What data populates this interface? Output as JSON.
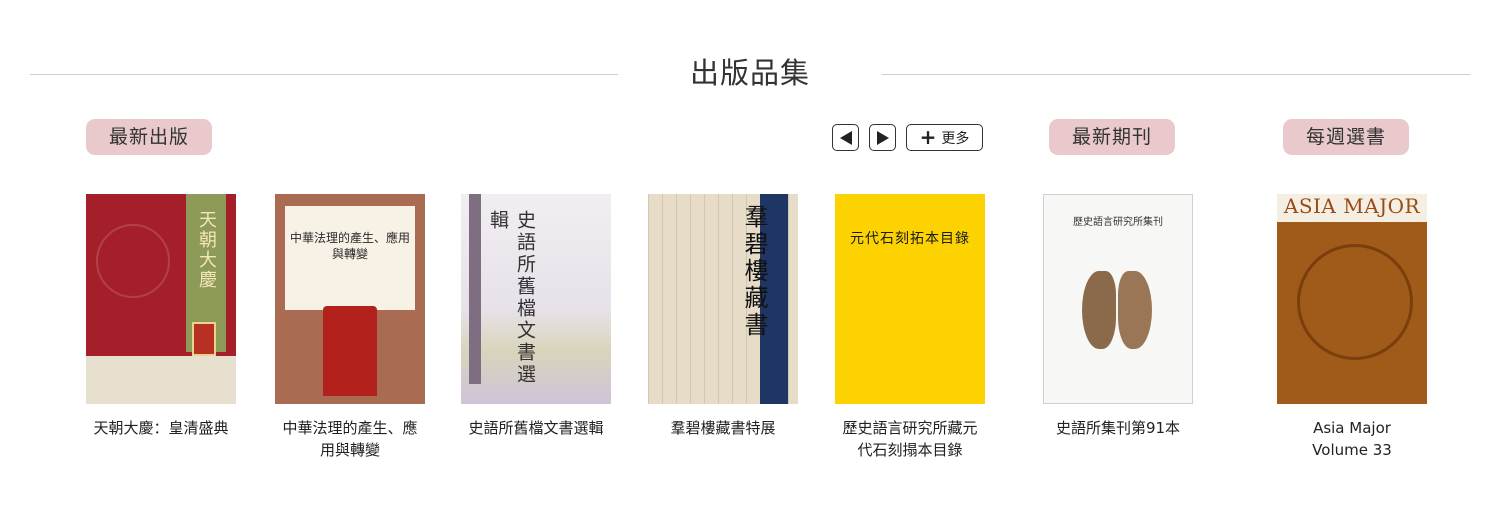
{
  "section": {
    "title": "出版品集"
  },
  "labels": {
    "latest_publications": "最新出版",
    "latest_journals": "最新期刊",
    "weekly_pick": "每週選書",
    "more": "更多"
  },
  "books": [
    {
      "caption": "天朝大慶：皇清盛典",
      "cover_text": "天朝大慶"
    },
    {
      "caption": "中華法理的產生、應用與轉變",
      "cover_text": "中華法理的產生、應用與轉變"
    },
    {
      "caption": "史語所舊檔文書選輯",
      "cover_text": "史語所舊檔文書選輯"
    },
    {
      "caption": "羣碧樓藏書特展",
      "cover_text": "羣碧樓藏書"
    },
    {
      "caption": "歷史語言研究所藏元代石刻搨本目錄",
      "cover_text": "元代石刻拓本目錄"
    }
  ],
  "journal": {
    "caption": "史語所集刊第91本",
    "cover_text": "歷史語言研究所集刊"
  },
  "weekly": {
    "caption": "Asia Major Volume 33",
    "cover_text": "ASIA MAJOR"
  },
  "colors": {
    "pill": "#e9c9cb",
    "divider": "#cfcfcf"
  },
  "icons": [
    "prev-arrow-icon",
    "next-arrow-icon",
    "plus-icon"
  ]
}
